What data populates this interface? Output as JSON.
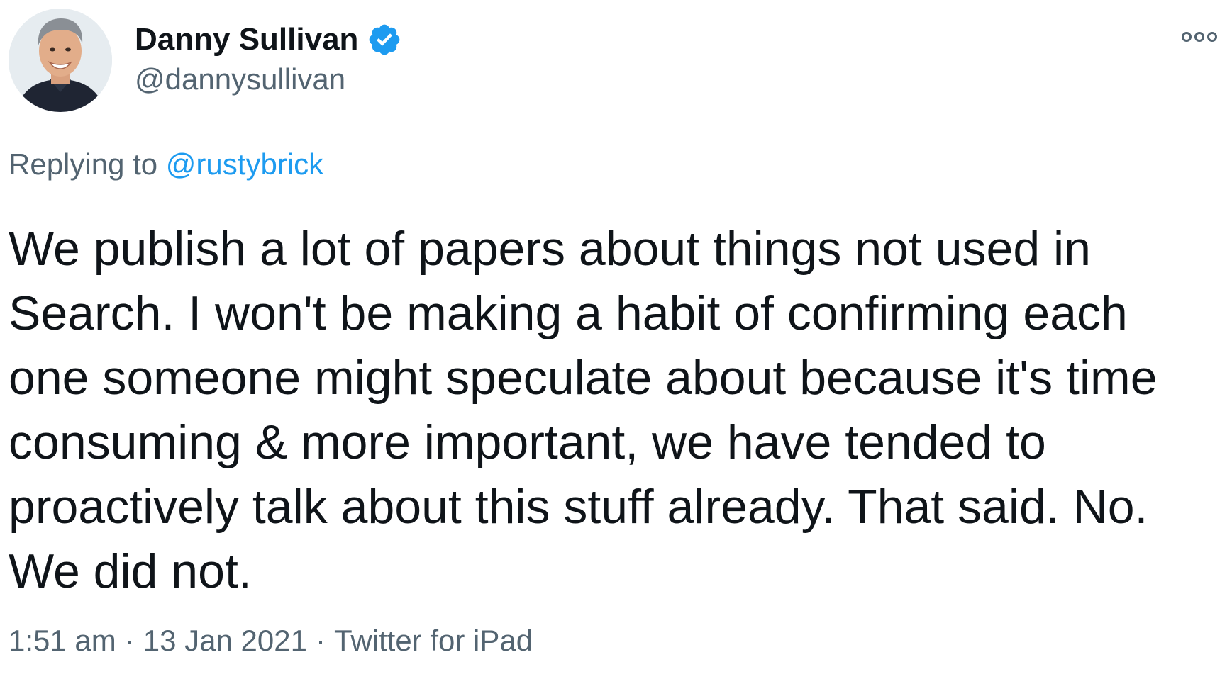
{
  "author": {
    "display_name": "Danny Sullivan",
    "handle": "@dannysullivan",
    "verified": true,
    "avatar_icon": "profile-photo"
  },
  "reply": {
    "prefix": "Replying to",
    "mention": "@rustybrick"
  },
  "tweet": {
    "lines": [
      "We publish a lot of papers about things not used in",
      "Search. I won't be making a habit of confirming each",
      "one someone might speculate about because it's time",
      "consuming & more important, we have tended to",
      "proactively talk about this stuff already. That said. No.",
      "We did not."
    ]
  },
  "meta": {
    "time": "1:51 am",
    "date": "13 Jan 2021",
    "source": "Twitter for iPad",
    "separator": "·"
  },
  "colors": {
    "accent": "#1d9bf0",
    "text_primary": "#0f1419",
    "text_secondary": "#536471"
  },
  "icons": {
    "verified": "verified-badge-icon",
    "more": "more-options-icon"
  }
}
